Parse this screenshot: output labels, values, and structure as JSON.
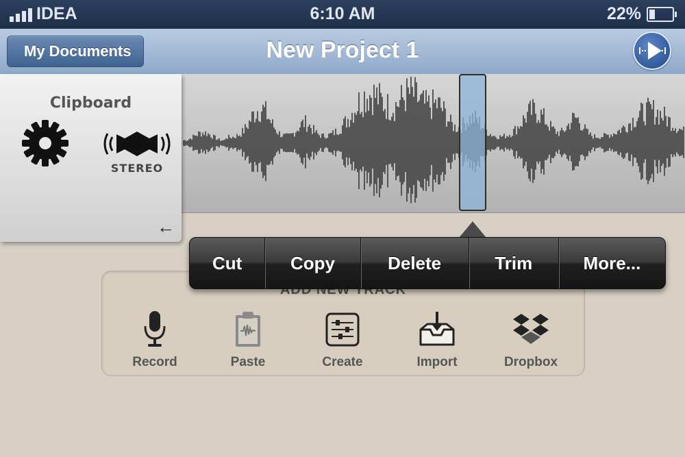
{
  "status_bar": {
    "carrier": "IDEA",
    "time": "6:10 AM",
    "battery_percent": "22%",
    "signal_bars": 4
  },
  "nav": {
    "back_label": "My Documents",
    "title": "New Project 1",
    "play_icon": "play-icon"
  },
  "clipboard_panel": {
    "title": "Clipboard",
    "settings_icon": "gear-icon",
    "speaker_icon": "stereo-speaker-icon",
    "stereo_label": "STEREO",
    "collapse_icon": "left-arrow-icon"
  },
  "edit_menu": {
    "items": [
      "Cut",
      "Copy",
      "Delete",
      "Trim",
      "More..."
    ]
  },
  "add_track": {
    "title": "ADD NEW TRACK",
    "buttons": [
      {
        "label": "Record",
        "icon": "microphone-icon"
      },
      {
        "label": "Paste",
        "icon": "clipboard-icon"
      },
      {
        "label": "Create",
        "icon": "mixer-icon"
      },
      {
        "label": "Import",
        "icon": "inbox-download-icon"
      },
      {
        "label": "Dropbox",
        "icon": "dropbox-icon"
      }
    ]
  },
  "colors": {
    "nav_accent": "#3f6290",
    "selection": "#8cb4d7",
    "menu_bg": "#2a2a2a"
  }
}
